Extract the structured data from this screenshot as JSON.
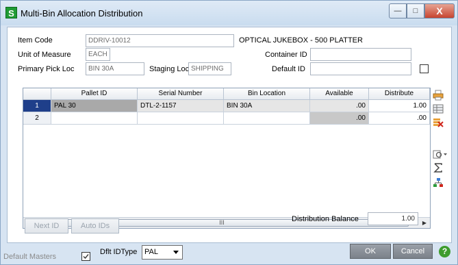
{
  "window": {
    "title": "Multi-Bin Allocation Distribution",
    "app_icon_letter": "S",
    "min_label": "—",
    "max_label": "□",
    "close_label": "X"
  },
  "header": {
    "item_code_label": "Item Code",
    "item_code_value": "DDRIV-10012",
    "item_desc": "OPTICAL JUKEBOX - 500 PLATTER",
    "uom_label": "Unit of Measure",
    "uom_value": "EACH",
    "container_id_label": "Container ID",
    "container_id_value": "",
    "primary_pick_label": "Primary Pick Loc",
    "primary_pick_value": "BIN 30A",
    "staging_loc_label": "Staging Loc",
    "staging_loc_value": "SHIPPING",
    "default_id_label": "Default ID",
    "default_id_value": ""
  },
  "grid": {
    "columns": [
      "Pallet ID",
      "Serial Number",
      "Bin Location",
      "Available",
      "Distribute"
    ],
    "rows": [
      {
        "num": "1",
        "pallet": "PAL 30",
        "serial": "DTL-2-1157",
        "bin": "BIN 30A",
        "available": ".00",
        "distribute": "1.00"
      },
      {
        "num": "2",
        "pallet": "",
        "serial": "",
        "bin": "",
        "available": ".00",
        "distribute": ".00"
      }
    ],
    "scroll_grip": "III",
    "scroll_left": "◀",
    "scroll_right": "▶"
  },
  "buttons": {
    "next_id": "Next ID",
    "auto_ids": "Auto IDs",
    "ok": "OK",
    "cancel": "Cancel",
    "help": "?"
  },
  "balance": {
    "label": "Distribution Balance",
    "value": "1.00"
  },
  "footer": {
    "default_masters_label": "Default Masters",
    "dflt_id_type_label": "Dflt IDType",
    "dflt_id_type_value": "PAL"
  },
  "colors": {
    "accent_green": "#1f9b34",
    "selected_row": "#1f3f8a",
    "available_gray": "#c8c8c8"
  }
}
